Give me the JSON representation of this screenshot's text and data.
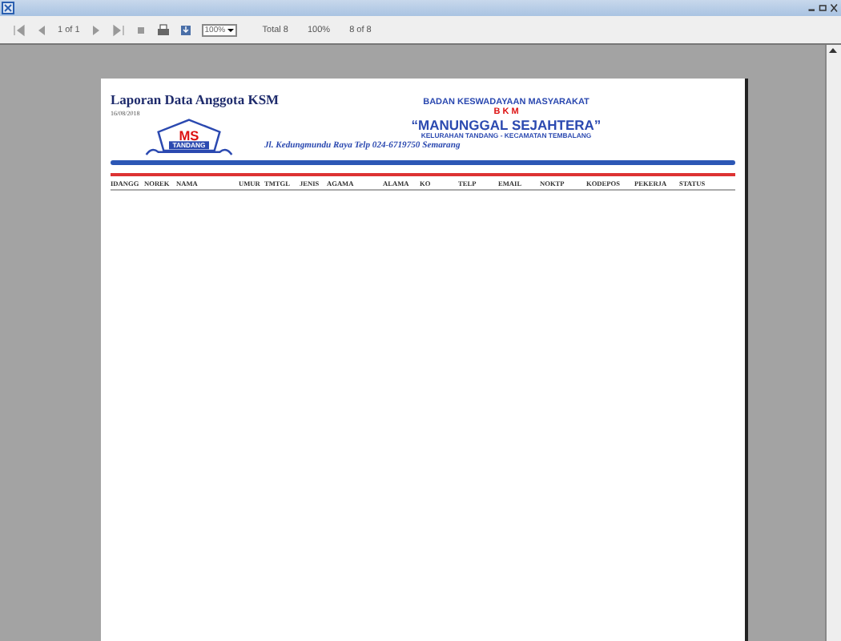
{
  "toolbar": {
    "page_indicator": "1 of 1",
    "zoom": "100%",
    "total": "Total 8",
    "percent": "100%",
    "records": "8 of 8"
  },
  "report": {
    "title": "Laporan Data Anggota KSM",
    "date": "16/08/2018",
    "logo": {
      "initials": "MS",
      "caption": "TANDANG"
    },
    "letterhead": [
      "BADAN KESWADAYAAN MASYARAKAT",
      "B K M",
      "“MANUNGGAL SEJAHTERA”",
      "KELURAHAN TANDANG - KECAMATAN TEMBALANG",
      "Jl. Kedungmundu Raya Telp 024-6719750 Semarang"
    ],
    "columns": [
      "IDANGG",
      "NOREK",
      "NAMA",
      "UMUR",
      "TMTGL",
      "JENIS",
      "AGAMA",
      "ALAMA",
      "KO",
      "TELP",
      "EMAIL",
      "NOKTP",
      "KODEPOS",
      "PEKERJA",
      "STATUS"
    ]
  }
}
